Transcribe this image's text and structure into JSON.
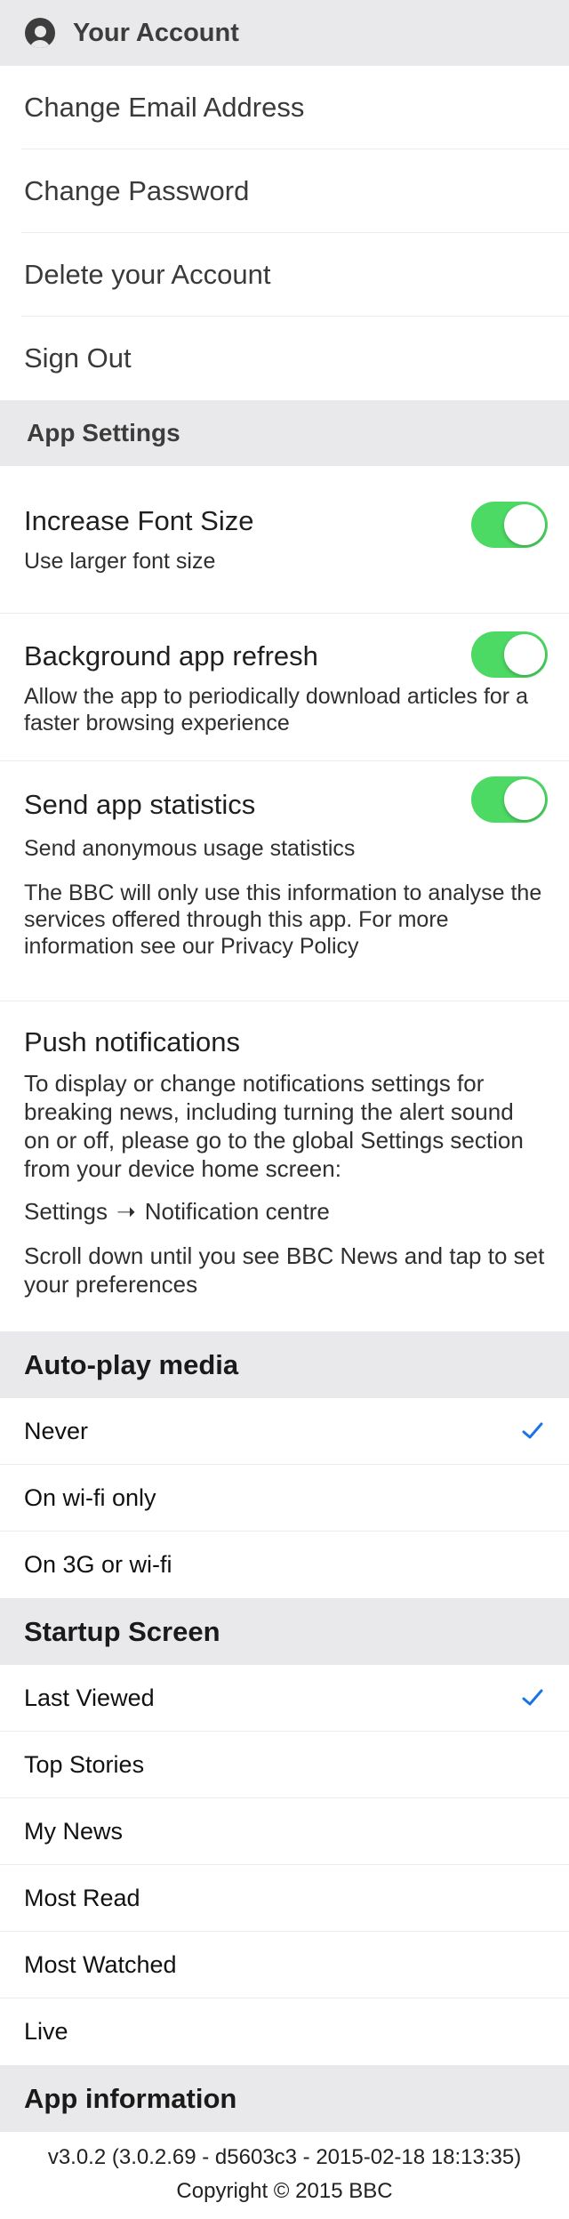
{
  "account": {
    "header": "Your Account",
    "header_icon": "user-avatar-icon",
    "items": [
      {
        "label": "Change Email Address"
      },
      {
        "label": "Change Password"
      },
      {
        "label": "Delete your Account"
      },
      {
        "label": "Sign Out"
      }
    ]
  },
  "app_settings": {
    "header": "App Settings",
    "font_size": {
      "label": "Increase Font Size",
      "desc": "Use larger font size",
      "enabled": true
    },
    "background_refresh": {
      "label": "Background app refresh",
      "desc": "Allow the app to periodically download articles for a faster browsing experience",
      "enabled": true
    },
    "statistics": {
      "label": "Send app statistics",
      "desc": "Send anonymous usage statistics",
      "privacy": "The BBC will only use this information to analyse the services offered through this app. For more information see our Privacy Policy",
      "enabled": true
    },
    "push": {
      "label": "Push notifications",
      "p1": "To display or change notifications settings for breaking news, including turning the alert sound on or off, please go to the global Settings section from your device home screen:",
      "path_from": "Settings",
      "path_arrow": "➝",
      "path_to": "Notification centre",
      "p3": "Scroll down until you see BBC News and tap to set your preferences"
    }
  },
  "autoplay": {
    "header": "Auto-play media",
    "options": [
      {
        "label": "Never",
        "selected": true
      },
      {
        "label": "On wi-fi only",
        "selected": false
      },
      {
        "label": "On 3G or wi-fi",
        "selected": false
      }
    ]
  },
  "startup": {
    "header": "Startup Screen",
    "options": [
      {
        "label": "Last Viewed",
        "selected": true
      },
      {
        "label": "Top Stories",
        "selected": false
      },
      {
        "label": "My News",
        "selected": false
      },
      {
        "label": "Most Read",
        "selected": false
      },
      {
        "label": "Most Watched",
        "selected": false
      },
      {
        "label": "Live",
        "selected": false
      }
    ]
  },
  "app_info": {
    "header": "App information",
    "version": "v3.0.2 (3.0.2.69 - d5603c3 - 2015-02-18 18:13:35)",
    "copyright": "Copyright © 2015 BBC"
  },
  "colors": {
    "toggle_on": "#4cd964",
    "checkmark": "#1a73e8",
    "header_bg": "#e9e9eb"
  }
}
